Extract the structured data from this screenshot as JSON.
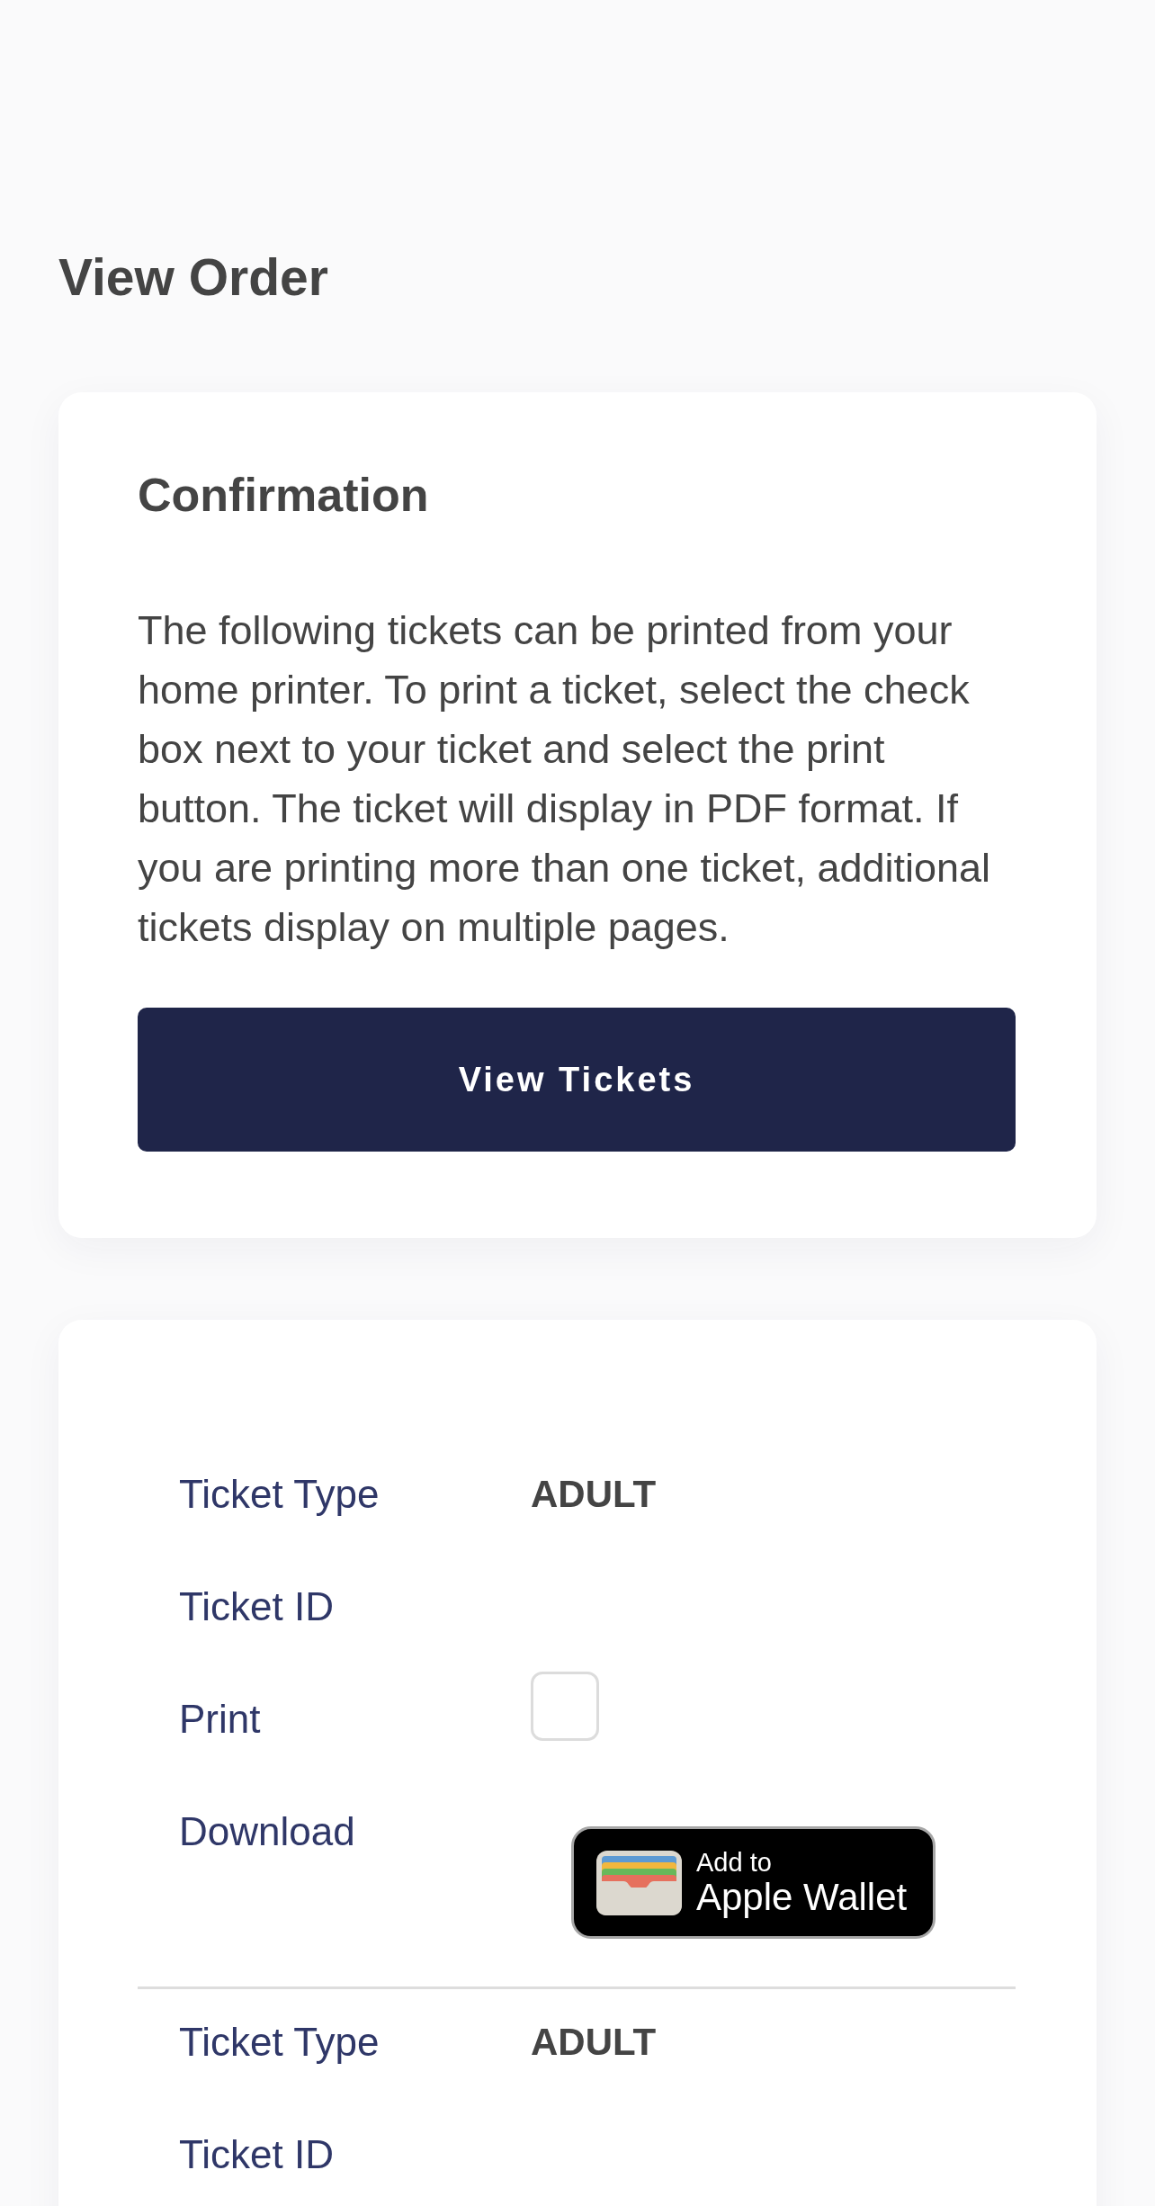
{
  "page": {
    "title": "View Order"
  },
  "confirmation": {
    "title": "Confirmation",
    "message": "The following tickets can be printed from your home printer. To print a ticket, select the check box next to your ticket and select the print button. The ticket will display in PDF format. If you are printing more than one ticket, additional tickets display on multiple pages.",
    "button": "View Tickets"
  },
  "tickets": [
    {
      "fields": [
        {
          "kind": "text",
          "label": "Ticket Type",
          "value": "ADULT"
        },
        {
          "kind": "text",
          "label": "Ticket ID"
        },
        {
          "kind": "checkbox",
          "label": "Print",
          "checked": false
        },
        {
          "kind": "wallet",
          "label": "Download",
          "button_line_1": "Add to",
          "button_line_2": "Apple Wallet"
        }
      ]
    },
    {
      "fields": [
        {
          "kind": "text",
          "label": "Ticket Type",
          "value": "ADULT"
        },
        {
          "kind": "text",
          "label": "Ticket ID"
        }
      ]
    }
  ]
}
